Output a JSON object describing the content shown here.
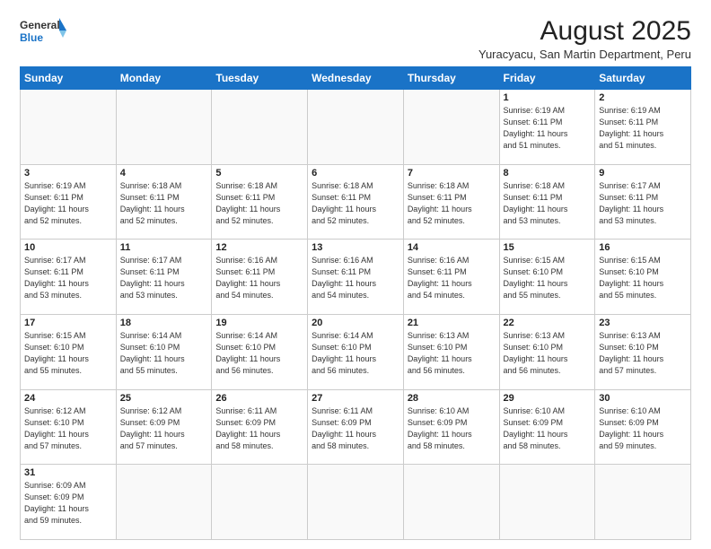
{
  "header": {
    "logo_line1": "General",
    "logo_line2": "Blue",
    "title": "August 2025",
    "subtitle": "Yuracyacu, San Martin Department, Peru"
  },
  "weekdays": [
    "Sunday",
    "Monday",
    "Tuesday",
    "Wednesday",
    "Thursday",
    "Friday",
    "Saturday"
  ],
  "weeks": [
    [
      {
        "day": "",
        "info": ""
      },
      {
        "day": "",
        "info": ""
      },
      {
        "day": "",
        "info": ""
      },
      {
        "day": "",
        "info": ""
      },
      {
        "day": "",
        "info": ""
      },
      {
        "day": "1",
        "info": "Sunrise: 6:19 AM\nSunset: 6:11 PM\nDaylight: 11 hours\nand 51 minutes."
      },
      {
        "day": "2",
        "info": "Sunrise: 6:19 AM\nSunset: 6:11 PM\nDaylight: 11 hours\nand 51 minutes."
      }
    ],
    [
      {
        "day": "3",
        "info": "Sunrise: 6:19 AM\nSunset: 6:11 PM\nDaylight: 11 hours\nand 52 minutes."
      },
      {
        "day": "4",
        "info": "Sunrise: 6:18 AM\nSunset: 6:11 PM\nDaylight: 11 hours\nand 52 minutes."
      },
      {
        "day": "5",
        "info": "Sunrise: 6:18 AM\nSunset: 6:11 PM\nDaylight: 11 hours\nand 52 minutes."
      },
      {
        "day": "6",
        "info": "Sunrise: 6:18 AM\nSunset: 6:11 PM\nDaylight: 11 hours\nand 52 minutes."
      },
      {
        "day": "7",
        "info": "Sunrise: 6:18 AM\nSunset: 6:11 PM\nDaylight: 11 hours\nand 52 minutes."
      },
      {
        "day": "8",
        "info": "Sunrise: 6:18 AM\nSunset: 6:11 PM\nDaylight: 11 hours\nand 53 minutes."
      },
      {
        "day": "9",
        "info": "Sunrise: 6:17 AM\nSunset: 6:11 PM\nDaylight: 11 hours\nand 53 minutes."
      }
    ],
    [
      {
        "day": "10",
        "info": "Sunrise: 6:17 AM\nSunset: 6:11 PM\nDaylight: 11 hours\nand 53 minutes."
      },
      {
        "day": "11",
        "info": "Sunrise: 6:17 AM\nSunset: 6:11 PM\nDaylight: 11 hours\nand 53 minutes."
      },
      {
        "day": "12",
        "info": "Sunrise: 6:16 AM\nSunset: 6:11 PM\nDaylight: 11 hours\nand 54 minutes."
      },
      {
        "day": "13",
        "info": "Sunrise: 6:16 AM\nSunset: 6:11 PM\nDaylight: 11 hours\nand 54 minutes."
      },
      {
        "day": "14",
        "info": "Sunrise: 6:16 AM\nSunset: 6:11 PM\nDaylight: 11 hours\nand 54 minutes."
      },
      {
        "day": "15",
        "info": "Sunrise: 6:15 AM\nSunset: 6:10 PM\nDaylight: 11 hours\nand 55 minutes."
      },
      {
        "day": "16",
        "info": "Sunrise: 6:15 AM\nSunset: 6:10 PM\nDaylight: 11 hours\nand 55 minutes."
      }
    ],
    [
      {
        "day": "17",
        "info": "Sunrise: 6:15 AM\nSunset: 6:10 PM\nDaylight: 11 hours\nand 55 minutes."
      },
      {
        "day": "18",
        "info": "Sunrise: 6:14 AM\nSunset: 6:10 PM\nDaylight: 11 hours\nand 55 minutes."
      },
      {
        "day": "19",
        "info": "Sunrise: 6:14 AM\nSunset: 6:10 PM\nDaylight: 11 hours\nand 56 minutes."
      },
      {
        "day": "20",
        "info": "Sunrise: 6:14 AM\nSunset: 6:10 PM\nDaylight: 11 hours\nand 56 minutes."
      },
      {
        "day": "21",
        "info": "Sunrise: 6:13 AM\nSunset: 6:10 PM\nDaylight: 11 hours\nand 56 minutes."
      },
      {
        "day": "22",
        "info": "Sunrise: 6:13 AM\nSunset: 6:10 PM\nDaylight: 11 hours\nand 56 minutes."
      },
      {
        "day": "23",
        "info": "Sunrise: 6:13 AM\nSunset: 6:10 PM\nDaylight: 11 hours\nand 57 minutes."
      }
    ],
    [
      {
        "day": "24",
        "info": "Sunrise: 6:12 AM\nSunset: 6:10 PM\nDaylight: 11 hours\nand 57 minutes."
      },
      {
        "day": "25",
        "info": "Sunrise: 6:12 AM\nSunset: 6:09 PM\nDaylight: 11 hours\nand 57 minutes."
      },
      {
        "day": "26",
        "info": "Sunrise: 6:11 AM\nSunset: 6:09 PM\nDaylight: 11 hours\nand 58 minutes."
      },
      {
        "day": "27",
        "info": "Sunrise: 6:11 AM\nSunset: 6:09 PM\nDaylight: 11 hours\nand 58 minutes."
      },
      {
        "day": "28",
        "info": "Sunrise: 6:10 AM\nSunset: 6:09 PM\nDaylight: 11 hours\nand 58 minutes."
      },
      {
        "day": "29",
        "info": "Sunrise: 6:10 AM\nSunset: 6:09 PM\nDaylight: 11 hours\nand 58 minutes."
      },
      {
        "day": "30",
        "info": "Sunrise: 6:10 AM\nSunset: 6:09 PM\nDaylight: 11 hours\nand 59 minutes."
      }
    ],
    [
      {
        "day": "31",
        "info": "Sunrise: 6:09 AM\nSunset: 6:09 PM\nDaylight: 11 hours\nand 59 minutes."
      },
      {
        "day": "",
        "info": ""
      },
      {
        "day": "",
        "info": ""
      },
      {
        "day": "",
        "info": ""
      },
      {
        "day": "",
        "info": ""
      },
      {
        "day": "",
        "info": ""
      },
      {
        "day": "",
        "info": ""
      }
    ]
  ]
}
